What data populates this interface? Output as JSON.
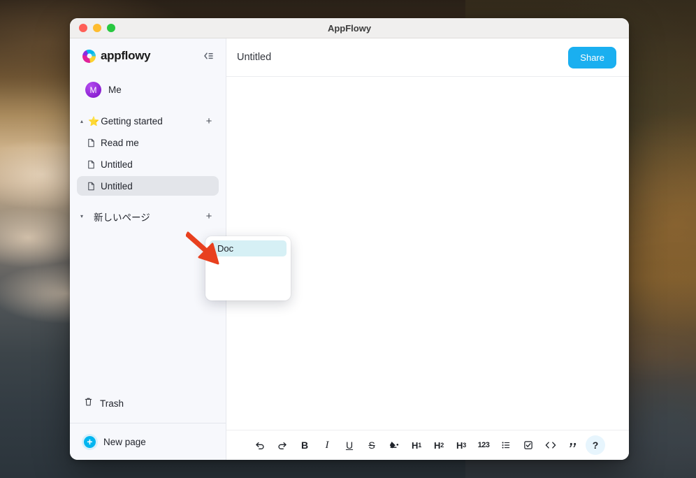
{
  "window": {
    "title": "AppFlowy",
    "traffic_lights": [
      "close",
      "minimize",
      "maximize"
    ]
  },
  "sidebar": {
    "brand": "appflowy",
    "brand_icon": "appflowy-logo-icon",
    "collapse_icon": "collapse-sidebar-icon",
    "user": {
      "name": "Me",
      "avatar_initial": "M",
      "avatar_color": "#9b27d6"
    },
    "sections": [
      {
        "emoji": "⭐",
        "label": "Getting started",
        "caret": "▴",
        "expanded": true,
        "add_label": "+",
        "pages": [
          {
            "label": "Read me",
            "icon": "document-icon",
            "selected": false
          },
          {
            "label": "Untitled",
            "icon": "document-icon",
            "selected": false
          },
          {
            "label": "Untitled",
            "icon": "document-icon",
            "selected": true
          }
        ]
      },
      {
        "emoji": "",
        "label": "新しいページ",
        "caret": "▾",
        "expanded": true,
        "add_label": "+",
        "pages": []
      }
    ],
    "trash": {
      "label": "Trash",
      "icon": "trash-icon"
    },
    "footer": {
      "label": "New page",
      "icon": "plus-circle-icon"
    }
  },
  "document": {
    "title": "Untitled",
    "title_placeholder": "Untitled",
    "share_label": "Share",
    "share_color": "#1aaff0",
    "body": ""
  },
  "popup": {
    "items": [
      {
        "label": "Doc",
        "highlighted": true
      }
    ],
    "highlight_color": "#d6f0f5"
  },
  "annotation": {
    "type": "red-arrow",
    "color": "#e8401f",
    "points_to": "Doc"
  },
  "toolbar": {
    "items": [
      {
        "name": "undo-icon",
        "label": "↶",
        "kind": "svg",
        "active": false
      },
      {
        "name": "redo-icon",
        "label": "↷",
        "kind": "svg",
        "active": false
      },
      {
        "name": "bold-icon",
        "label": "B",
        "kind": "text",
        "active": false
      },
      {
        "name": "italic-icon",
        "label": "I",
        "kind": "text",
        "active": false
      },
      {
        "name": "underline-icon",
        "label": "U",
        "kind": "text",
        "active": false
      },
      {
        "name": "strikethrough-icon",
        "label": "S",
        "kind": "text",
        "active": false
      },
      {
        "name": "highlight-color-icon",
        "label": "◢",
        "kind": "svg",
        "active": false
      },
      {
        "name": "heading-1-icon",
        "label": "H1",
        "kind": "head",
        "active": false
      },
      {
        "name": "heading-2-icon",
        "label": "H2",
        "kind": "head",
        "active": false
      },
      {
        "name": "heading-3-icon",
        "label": "H3",
        "kind": "head",
        "active": false
      },
      {
        "name": "numbered-list-icon",
        "label": "123",
        "kind": "num",
        "active": false
      },
      {
        "name": "bulleted-list-icon",
        "label": "☰",
        "kind": "svg",
        "active": false
      },
      {
        "name": "checklist-icon",
        "label": "☑",
        "kind": "svg",
        "active": false
      },
      {
        "name": "code-icon",
        "label": "<>",
        "kind": "svg",
        "active": false
      },
      {
        "name": "quote-icon",
        "label": "”",
        "kind": "svg",
        "active": false
      },
      {
        "name": "help-icon",
        "label": "?",
        "kind": "text",
        "active": true
      }
    ]
  }
}
